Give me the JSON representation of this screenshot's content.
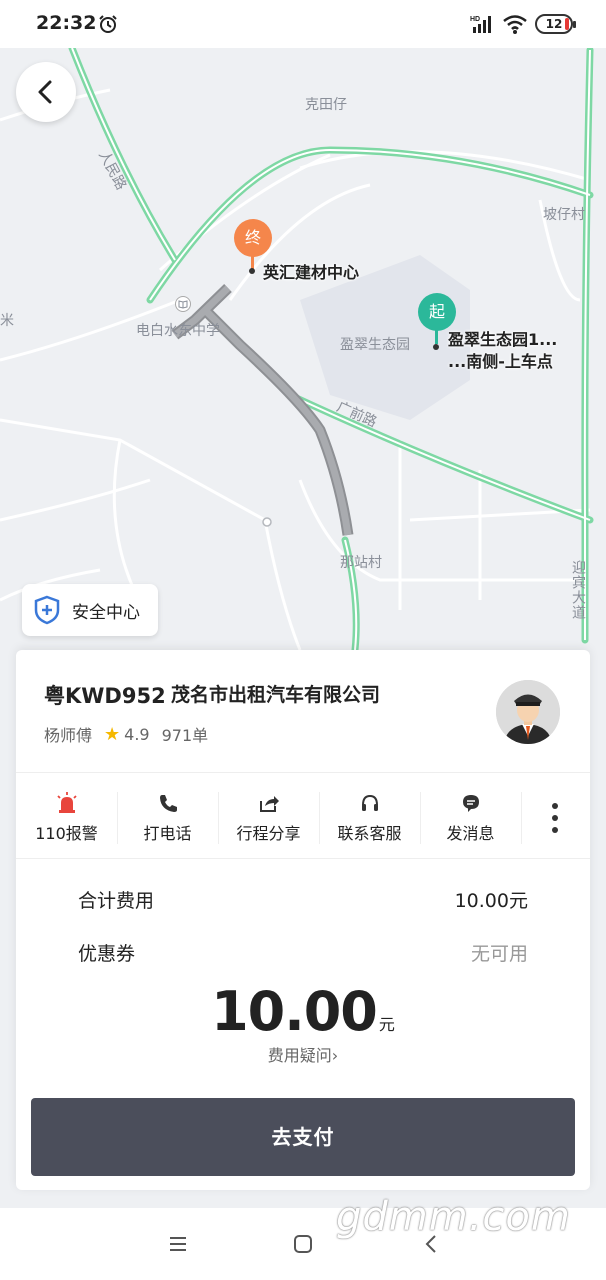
{
  "status_bar": {
    "time": "22:32",
    "battery_level": "12"
  },
  "map": {
    "labels": {
      "ketianzai": "克田仔",
      "bozaicun": "坡仔村",
      "renmin_road": "人民路",
      "guangqian_road": "广前路",
      "dianbai_school": "电白水东中学",
      "yingcui_park": "盈翠生态园",
      "nazhan_village": "那站村",
      "yingbin_avenue": "迎宾大道",
      "mi": "米"
    },
    "destination": {
      "pin_label": "终",
      "name": "英汇建材中心",
      "color": "#f5864b"
    },
    "origin": {
      "pin_label": "起",
      "name_line1": "盈翠生态园1...",
      "name_line2": "...南侧-上车点",
      "color": "#2bb89a"
    }
  },
  "safety_center": {
    "label": "安全中心",
    "icon": "shield-plus-icon"
  },
  "trip": {
    "plate": "粤KWD952",
    "company": "茂名市出租汽车有限公司",
    "driver_name": "杨师傅",
    "rating": "4.9",
    "orders": "971单"
  },
  "actions": [
    {
      "label": "110报警",
      "icon": "alarm-siren-icon"
    },
    {
      "label": "打电话",
      "icon": "phone-icon"
    },
    {
      "label": "行程分享",
      "icon": "share-icon"
    },
    {
      "label": "联系客服",
      "icon": "headset-icon"
    },
    {
      "label": "发消息",
      "icon": "message-icon"
    }
  ],
  "fees": {
    "total_label": "合计费用",
    "total_value": "10.00元",
    "coupon_label": "优惠券",
    "coupon_value": "无可用",
    "amount": "10.00",
    "unit": "元",
    "question": "费用疑问",
    "question_chevron": "›"
  },
  "pay_button": "去支付",
  "watermark": "gdmm.com",
  "colors": {
    "route_green": "#7ed8a4",
    "pay_button": "#4b4e5b",
    "alarm_red": "#e8453c"
  }
}
